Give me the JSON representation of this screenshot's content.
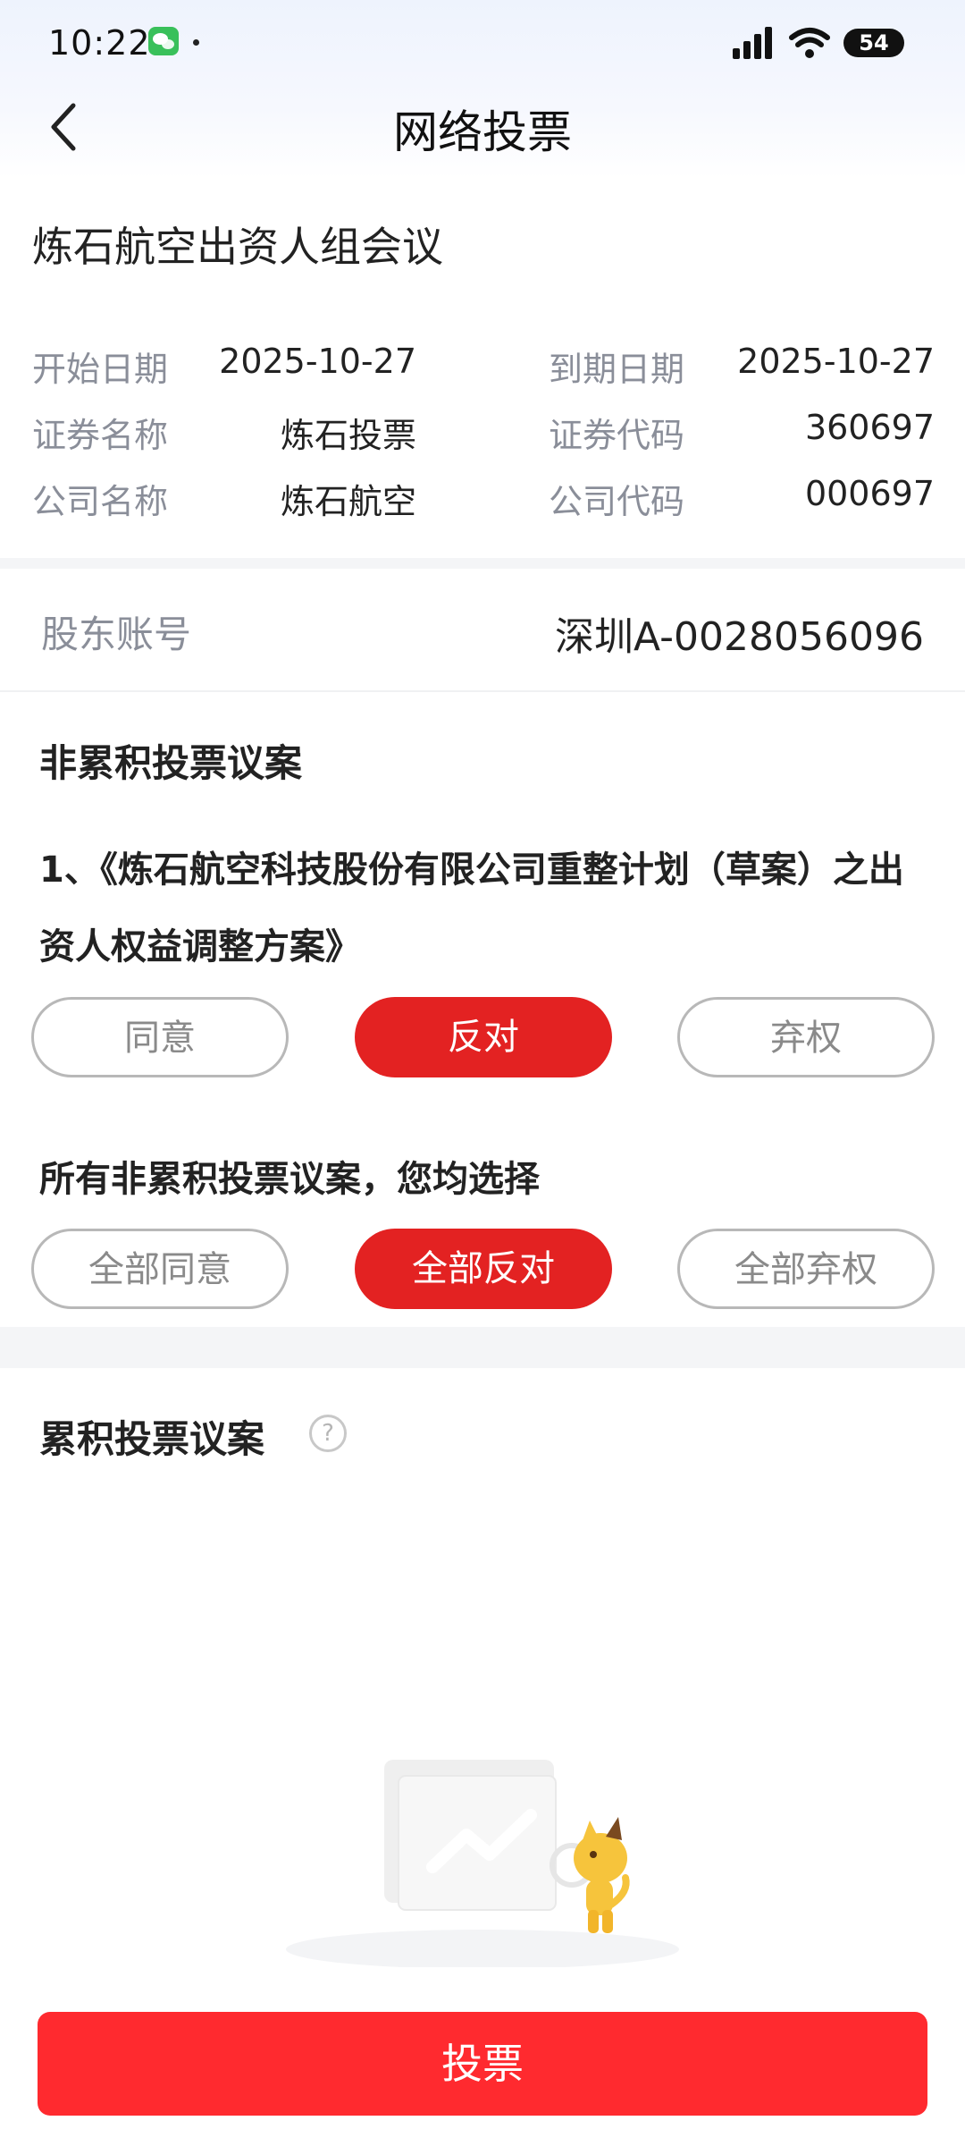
{
  "status_bar": {
    "time": "10:22",
    "battery": "54",
    "icons": [
      "wechat-icon",
      "signal-icon",
      "wifi-icon",
      "battery-icon"
    ]
  },
  "header": {
    "title": "网络投票",
    "back_icon": "chevron-left-icon"
  },
  "meeting": {
    "title": "炼石航空出资人组会议",
    "start_date_label": "开始日期",
    "start_date": "2025-10-27",
    "end_date_label": "到期日期",
    "end_date": "2025-10-27",
    "security_name_label": "证券名称",
    "security_name": "炼石投票",
    "security_code_label": "证券代码",
    "security_code": "360697",
    "company_name_label": "公司名称",
    "company_name": "炼石航空",
    "company_code_label": "公司代码",
    "company_code": "000697"
  },
  "account": {
    "label": "股东账号",
    "value": "深圳A-0028056096"
  },
  "non_cumulative": {
    "title": "非累积投票议案",
    "proposal": "1、《炼石航空科技股份有限公司重整计划（草案）之出资人权益调整方案》",
    "options": [
      "同意",
      "反对",
      "弃权"
    ],
    "selected": "反对",
    "bulk_title": "所有非累积投票议案，您均选择",
    "bulk_options": [
      "全部同意",
      "全部反对",
      "全部弃权"
    ],
    "bulk_selected": "全部反对"
  },
  "cumulative": {
    "title": "累积投票议案",
    "help_icon": "question-circle-icon",
    "help_glyph": "?"
  },
  "footer": {
    "vote_label": "投票"
  },
  "colors": {
    "accent": "#e32222",
    "vote_button": "#ff2a2f",
    "label_gray": "#8a8e99"
  }
}
